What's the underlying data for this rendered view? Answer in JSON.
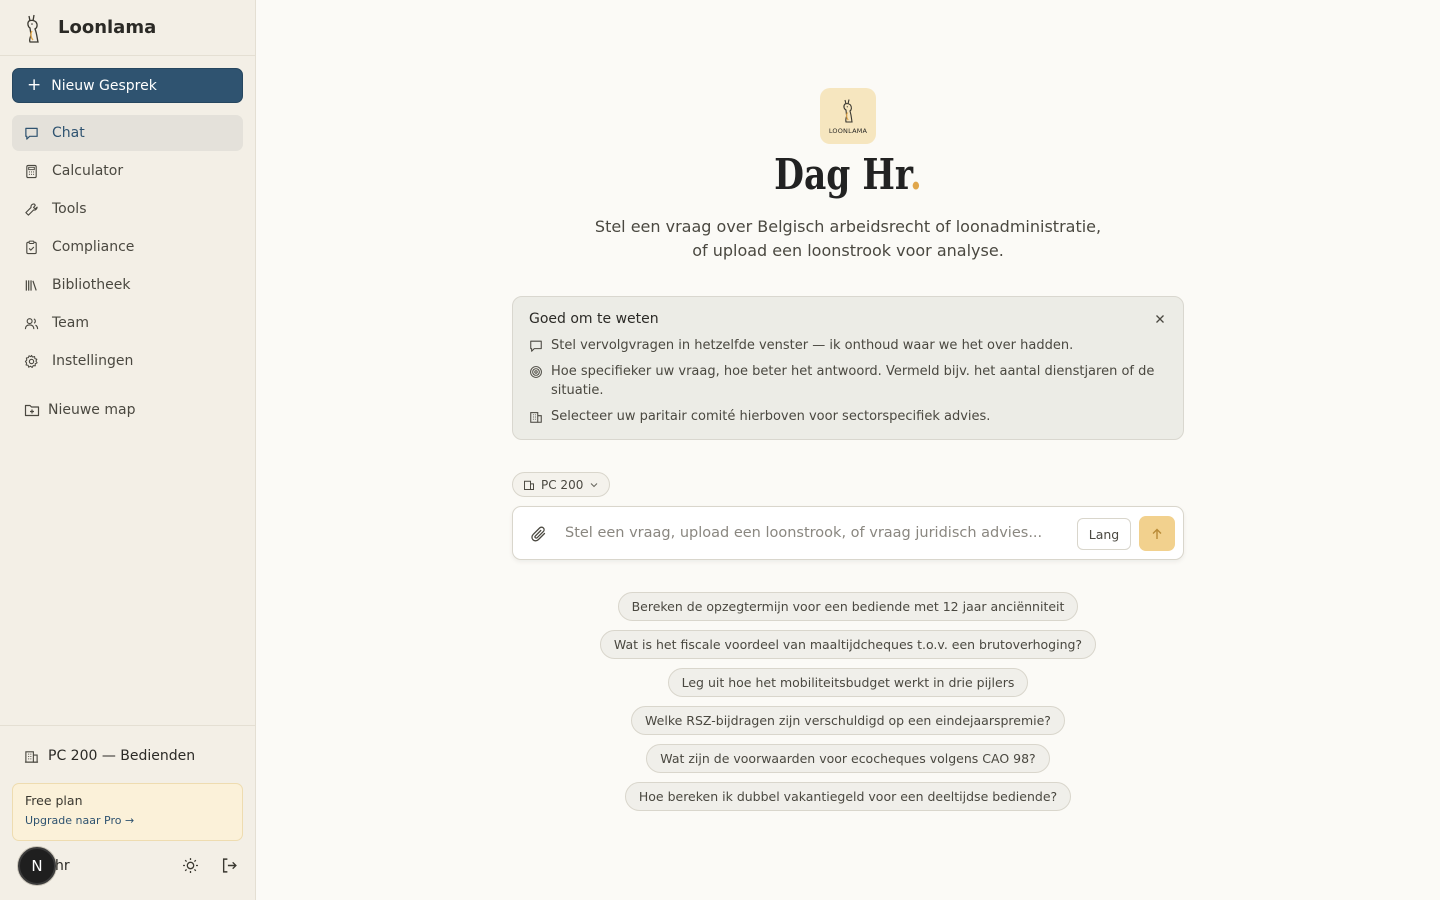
{
  "app": {
    "name": "Loonlama"
  },
  "sidebar": {
    "new_chat_label": "Nieuw Gesprek",
    "items": [
      {
        "label": "Chat",
        "icon": "chat-icon",
        "active": true
      },
      {
        "label": "Calculator",
        "icon": "calculator-icon"
      },
      {
        "label": "Tools",
        "icon": "wrench-icon"
      },
      {
        "label": "Compliance",
        "icon": "clipboard-check-icon"
      },
      {
        "label": "Bibliotheek",
        "icon": "library-icon"
      },
      {
        "label": "Team",
        "icon": "users-icon"
      },
      {
        "label": "Instellingen",
        "icon": "gear-icon"
      }
    ],
    "new_folder_label": "Nieuwe map",
    "committee_label": "PC 200 — Bedienden",
    "plan": {
      "title": "Free plan",
      "upgrade_label": "Upgrade naar Pro →"
    },
    "user": {
      "initial": "N",
      "name": "hr"
    }
  },
  "main": {
    "logo_text": "LOONLAMA",
    "greeting": "Dag Hr",
    "greeting_punct": ".",
    "subtitle_line1": "Stel een vraag over Belgisch arbeidsrecht of loonadministratie,",
    "subtitle_line2": "of upload een loonstrook voor analyse.",
    "tips": {
      "title": "Goed om te weten",
      "items": [
        "Stel vervolgvragen in hetzelfde venster — ik onthoud waar we het over hadden.",
        "Hoe specifieker uw vraag, hoe beter het antwoord. Vermeld bijv. het aantal dienstjaren of de situatie.",
        "Selecteer uw paritair comité hierboven voor sectorspecifiek advies."
      ]
    },
    "committee_chip": "PC 200",
    "input": {
      "placeholder": "Stel een vraag, upload een loonstrook, of vraag juridisch advies...",
      "value": "",
      "lang_label": "Lang"
    },
    "suggestions": [
      "Bereken de opzegtermijn voor een bediende met 12 jaar anciënniteit",
      "Wat is het fiscale voordeel van maaltijdcheques t.o.v. een brutoverhoging?",
      "Leg uit hoe het mobiliteitsbudget werkt in drie pijlers",
      "Welke RSZ-bijdragen zijn verschuldigd op een eindejaarspremie?",
      "Wat zijn de voorwaarden voor ecocheques volgens CAO 98?",
      "Hoe bereken ik dubbel vakantiegeld voor een deeltijdse bediende?"
    ]
  },
  "colors": {
    "accent": "#2f5370",
    "brand_gold": "#e0a64b",
    "send": "#f2d18e",
    "sidebar_bg": "#f3efe6"
  }
}
